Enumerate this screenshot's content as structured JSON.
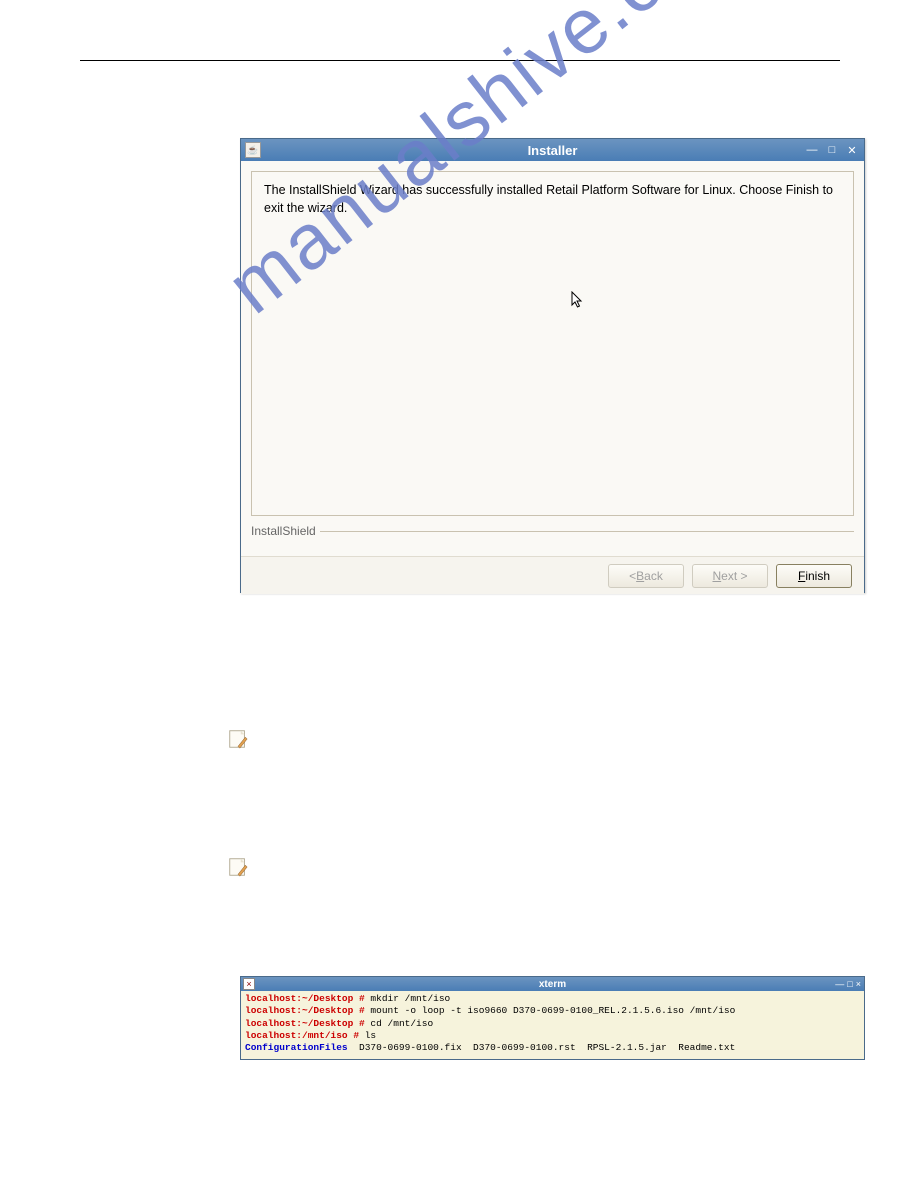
{
  "watermark": "manualshive.com",
  "installer": {
    "title": "Installer",
    "java_icon": "☕",
    "message": "The InstallShield Wizard has successfully installed Retail Platform Software for Linux. Choose Finish to exit the wizard.",
    "separator_label": "InstallShield",
    "buttons": {
      "back": "< Back",
      "back_underline": "B",
      "back_rest": "ack",
      "back_prefix": "< ",
      "next": "Next >",
      "next_underline": "N",
      "next_rest": "ext >",
      "finish": "Finish",
      "finish_underline": "F",
      "finish_rest": "inish"
    }
  },
  "xterm": {
    "title": "xterm",
    "lines": [
      {
        "prompt": "localhost:~/Desktop #",
        "cmd": " mkdir /mnt/iso"
      },
      {
        "prompt": "localhost:~/Desktop #",
        "cmd": " mount -o loop -t iso9660 D370-0699-0100_REL.2.1.5.6.iso /mnt/iso"
      },
      {
        "prompt": "localhost:~/Desktop #",
        "cmd": " cd /mnt/iso"
      },
      {
        "prompt": "localhost:/mnt/iso #",
        "cmd": " ls"
      }
    ],
    "output": {
      "dir": "ConfigurationFiles",
      "files": "  D370-0699-0100.fix  D370-0699-0100.rst  RPSL-2.1.5.jar  Readme.txt"
    }
  }
}
